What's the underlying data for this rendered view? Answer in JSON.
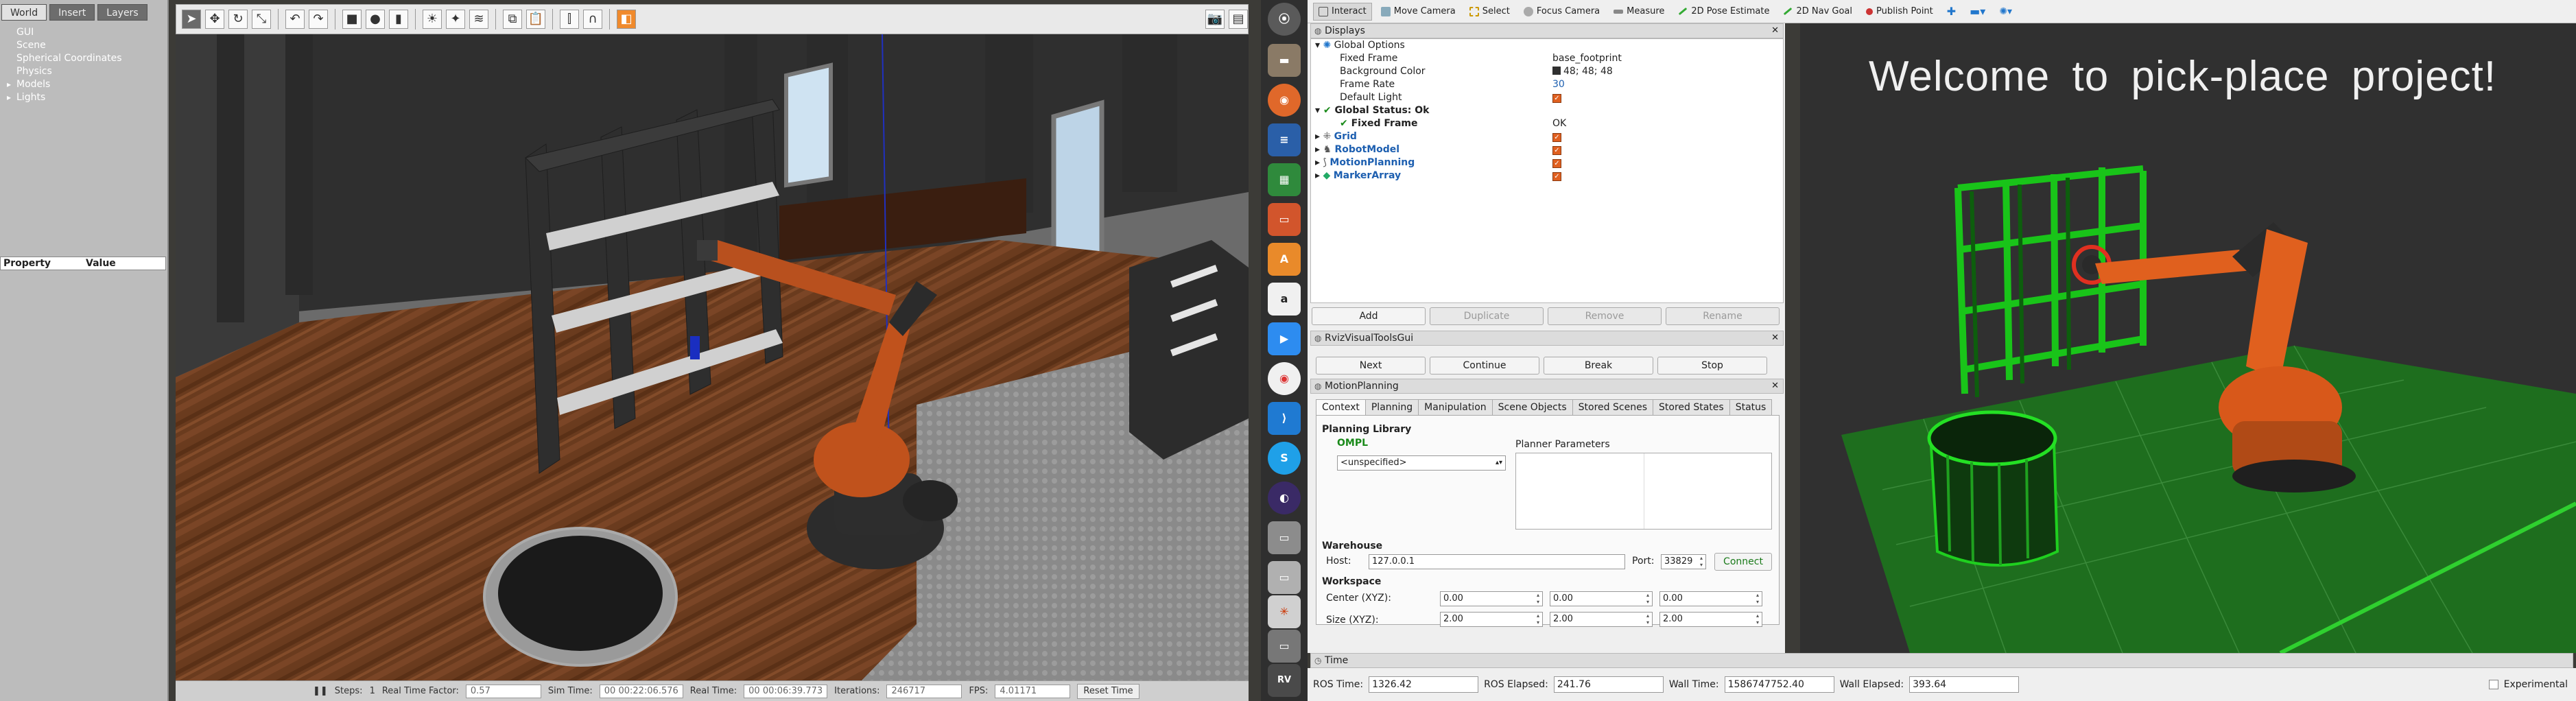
{
  "gazebo": {
    "tabs": [
      "World",
      "Insert",
      "Layers"
    ],
    "tree": [
      "GUI",
      "Scene",
      "Spherical Coordinates",
      "Physics",
      "Models",
      "Lights"
    ],
    "prop_headers": [
      "Property",
      "Value"
    ],
    "status": {
      "steps_label": "Steps:",
      "steps_value": "1",
      "rtf_label": "Real Time Factor:",
      "rtf_value": "0.57",
      "sim_label": "Sim Time:",
      "sim_value": "00 00:22:06.576",
      "real_label": "Real Time:",
      "real_value": "00 00:06:39.773",
      "iter_label": "Iterations:",
      "iter_value": "246717",
      "fps_label": "FPS:",
      "fps_value": "4.01171",
      "reset": "Reset Time"
    }
  },
  "rviz": {
    "toolbar": [
      "Interact",
      "Move Camera",
      "Select",
      "Focus Camera",
      "Measure",
      "2D Pose Estimate",
      "2D Nav Goal",
      "Publish Point"
    ],
    "displays_title": "Displays",
    "displays": {
      "global_options": "Global Options",
      "fixed_frame": "Fixed Frame",
      "fixed_frame_value": "base_footprint",
      "bg_color": "Background Color",
      "bg_color_value": "48; 48; 48",
      "frame_rate": "Frame Rate",
      "frame_rate_value": "30",
      "default_light": "Default Light",
      "global_status": "Global Status: Ok",
      "status_fixed_frame": "Fixed Frame",
      "status_fixed_frame_value": "OK",
      "grid": "Grid",
      "robot_model": "RobotModel",
      "motion_planning": "MotionPlanning",
      "marker_array": "MarkerArray"
    },
    "display_buttons": [
      "Add",
      "Duplicate",
      "Remove",
      "Rename"
    ],
    "rvt_title": "RvizVisualToolsGui",
    "rvt_buttons": [
      "Next",
      "Continue",
      "Break",
      "Stop"
    ],
    "mp_title": "MotionPlanning",
    "mp_tabs": [
      "Context",
      "Planning",
      "Manipulation",
      "Scene Objects",
      "Stored Scenes",
      "Stored States",
      "Status"
    ],
    "mp": {
      "planning_library": "Planning Library",
      "ompl": "OMPL",
      "planner": "<unspecified>",
      "planner_params": "Planner Parameters",
      "warehouse": "Warehouse",
      "host_label": "Host:",
      "host_value": "127.0.0.1",
      "port_label": "Port:",
      "port_value": "33829",
      "connect": "Connect",
      "workspace": "Workspace",
      "center_label": "Center (XYZ):",
      "center": [
        "0.00",
        "0.00",
        "0.00"
      ],
      "size_label": "Size (XYZ):",
      "size": [
        "2.00",
        "2.00",
        "2.00"
      ]
    },
    "time_title": "Time",
    "time": {
      "ros_time_label": "ROS Time:",
      "ros_time": "1326.42",
      "ros_elapsed_label": "ROS Elapsed:",
      "ros_elapsed": "241.76",
      "wall_time_label": "Wall Time:",
      "wall_time": "1586747752.40",
      "wall_elapsed_label": "Wall Elapsed:",
      "wall_elapsed": "393.64",
      "experimental": "Experimental"
    },
    "welcome": "Welcome to pick-place project!"
  },
  "dock_icons": [
    "rviz-icon",
    "files-icon",
    "firefox-icon",
    "writer-icon",
    "calc-icon",
    "impress-icon",
    "software-icon",
    "amazon-icon",
    "zoom-icon",
    "chrome-icon",
    "vscode-icon",
    "skype-icon",
    "eclipse-icon",
    "drive-icon",
    "disk-icon",
    "gazebo-icon",
    "usb-icon",
    "rviz2-icon",
    "rviz3-icon"
  ]
}
